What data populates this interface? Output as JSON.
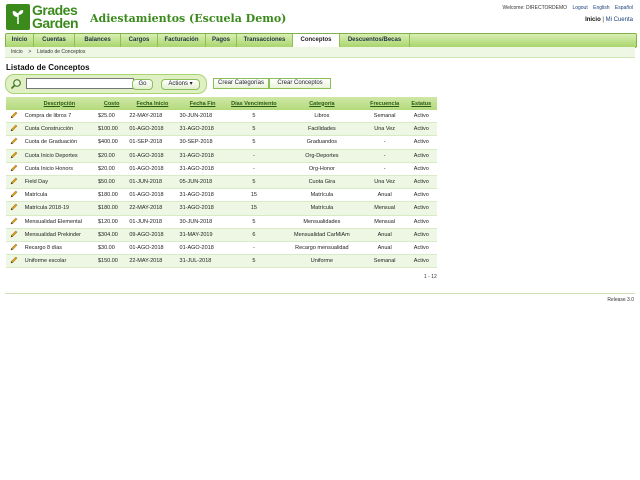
{
  "brand": {
    "logo_line1": "Grades",
    "logo_line2": "Garden",
    "school_name": "Adiestamientos (Escuela Demo)"
  },
  "toplinks": {
    "welcome": "Welcome: DIRECTORDEMO",
    "logout": "Logout",
    "english": "English",
    "espanol": "Español"
  },
  "account": {
    "inicio": "Inicio",
    "sep": "|",
    "mi_cuenta": "Mi Cuenta"
  },
  "nav": {
    "tabs": [
      "Inicio",
      "Cuentas",
      "Balances",
      "Cargos",
      "Facturación",
      "Pagos",
      "Transacciones",
      "Conceptos",
      "Descuentos/Becas"
    ],
    "active": "Conceptos"
  },
  "breadcrumb": {
    "home": "Inicio",
    "sep": ">",
    "current": "Listado de Conceptos"
  },
  "page": {
    "title": "Listado de Conceptos"
  },
  "toolbar": {
    "search_value": "",
    "go_label": "Go",
    "actions_label": "Actions ▾",
    "crear_categorias": "Crear Categorías",
    "crear_conceptos": "Crear Conceptos"
  },
  "table": {
    "headers": [
      "Descripción",
      "Costo",
      "Fecha Inicio",
      "Fecha Fin",
      "Días Vencimiento",
      "Categoría",
      "Frecuencia",
      "Estatus"
    ],
    "rows": [
      [
        "Compra de libros 7",
        "$25.00",
        "22-MAY-2018",
        "30-JUN-2018",
        "5",
        "Libros",
        "Semanal",
        "Activo"
      ],
      [
        "Cuota Construcción",
        "$100.00",
        "01-AGO-2018",
        "31-AGO-2018",
        "5",
        "Facilidades",
        "Una Vez",
        "Activo"
      ],
      [
        "Cuota de Graduación",
        "$400.00",
        "01-SEP-2018",
        "30-SEP-2018",
        "5",
        "Graduandos",
        "-",
        "Activo"
      ],
      [
        "Cuota Inicio Deportes",
        "$20.00",
        "01-AGO-2018",
        "31-AGO-2018",
        "-",
        "Org-Deportes",
        "-",
        "Activo"
      ],
      [
        "Cuota Inicio Honors",
        "$20.00",
        "01-AGO-2018",
        "31-AGO-2018",
        "-",
        "Org-Honor",
        "-",
        "Activo"
      ],
      [
        "Field Day",
        "$50.00",
        "01-JUN-2018",
        "05-JUN-2018",
        "5",
        "Cuota Gira",
        "Una Vez",
        "Activo"
      ],
      [
        "Matrícula",
        "$180.00",
        "01-AGO-2018",
        "31-AGO-2018",
        "15",
        "Matrícula",
        "Anual",
        "Activo"
      ],
      [
        "Matrícula 2018-19",
        "$180.00",
        "22-MAY-2018",
        "31-AGO-2018",
        "15",
        "Matrícula",
        "Mensual",
        "Activo"
      ],
      [
        "Mensualidad Elemental",
        "$120.00",
        "01-JUN-2018",
        "30-JUN-2018",
        "5",
        "Mensualidades",
        "Mensual",
        "Activo"
      ],
      [
        "Mensualidad Prekinder",
        "$304.00",
        "09-AGO-2018",
        "31-MAY-2019",
        "6",
        "Mensualidad CarMiAm",
        "Anual",
        "Activo"
      ],
      [
        "Recargo 8 días",
        "$30.00",
        "01-AGO-2018",
        "01-AGO-2018",
        "-",
        "Recargo mensualidad",
        "Anual",
        "Activo"
      ],
      [
        "Uniforme escolar",
        "$150.00",
        "22-MAY-2018",
        "31-JUL-2018",
        "5",
        "Uniforme",
        "Semanal",
        "Activo"
      ]
    ]
  },
  "pager": "1 - 12",
  "footer": {
    "release": "Release 3.0"
  },
  "colors": {
    "brand_green": "#3a8a1c",
    "nav_green": "#a9d56e",
    "row_alt": "#eef7e3"
  },
  "icons": {
    "logo": "leaf-icon",
    "search": "magnifier-icon",
    "edit": "pencil-icon"
  }
}
